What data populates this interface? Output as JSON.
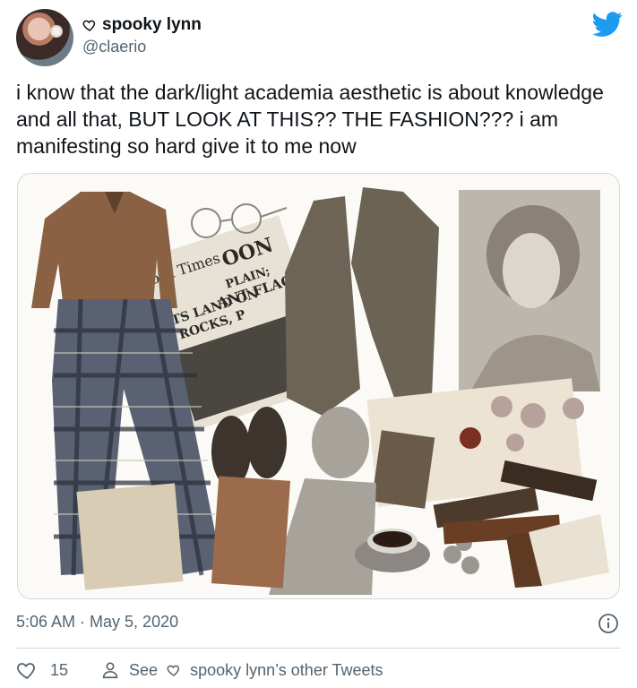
{
  "user": {
    "display_name": "spooky lynn",
    "handle": "@claerio"
  },
  "tweet": {
    "text": "i know that the dark/light academia aesthetic is about knowledge and all that, BUT LOOK AT THIS?? THE FASHION??? i am manifesting so hard give it to me now",
    "timestamp": "5:06 AM · May 5, 2020"
  },
  "media": {
    "newspaper_masthead": "ork Times",
    "headline_1": "OON",
    "headline_2": "PLAIN;",
    "headline_3": "ANT FLAG",
    "headline_4": "UTS LAND ON",
    "headline_5": "T ROCKS, P"
  },
  "actions": {
    "like_count": "15",
    "see_prefix": "See",
    "see_suffix": "spooky lynn’s other Tweets"
  },
  "colors": {
    "brand": "#1d9bf0",
    "text_secondary": "#536471",
    "border": "#cfd9de"
  },
  "icons": [
    "heart-icon",
    "twitter-bird-icon",
    "info-icon",
    "person-icon"
  ]
}
